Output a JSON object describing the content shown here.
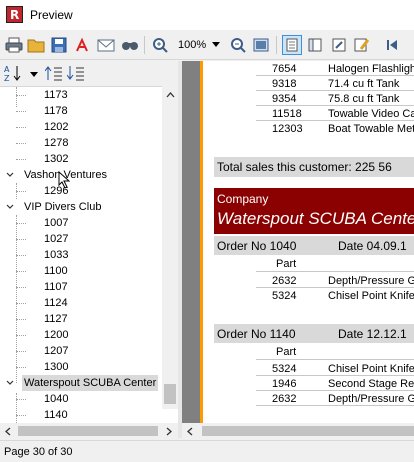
{
  "window": {
    "title": "Preview"
  },
  "toolbar": {
    "zoom": "100%"
  },
  "tree": {
    "items_top": [
      "1173",
      "1178",
      "1202",
      "1278",
      "1302"
    ],
    "vashon": {
      "label": "Vashon Ventures",
      "children": [
        "1296"
      ]
    },
    "vip": {
      "label": "VIP Divers Club",
      "children": [
        "1007",
        "1027",
        "1033",
        "1100",
        "1107",
        "1124",
        "1127",
        "1200",
        "1207",
        "1300"
      ]
    },
    "waterspout": {
      "label": "Waterspout SCUBA Center",
      "children": [
        "1040",
        "1140"
      ]
    }
  },
  "report": {
    "top_rows": [
      {
        "part": "7654",
        "desc": "Halogen Flashligh"
      },
      {
        "part": "9318",
        "desc": "71.4 cu ft Tank"
      },
      {
        "part": "9354",
        "desc": "75.8 cu ft Tank"
      },
      {
        "part": "11518",
        "desc": "Towable Video Ca"
      },
      {
        "part": "12303",
        "desc": "Boat Towable Met"
      }
    ],
    "total": "Total sales this customer: 225 56",
    "company_label": "Company",
    "company_name": "Waterspout SCUBA Cente",
    "order1": {
      "no": "Order No 1040",
      "date": "Date 04.09.1",
      "part_header": "Part",
      "rows": [
        {
          "part": "2632",
          "desc": "Depth/Pressure G"
        },
        {
          "part": "5324",
          "desc": "Chisel Point Knife"
        }
      ]
    },
    "order2": {
      "no": "Order No 1140",
      "date": "Date 12.12.1",
      "part_header": "Part",
      "rows": [
        {
          "part": "5324",
          "desc": "Chisel Point Knife"
        },
        {
          "part": "1946",
          "desc": "Second Stage Reg"
        },
        {
          "part": "2632",
          "desc": "Depth/Pressure G"
        }
      ]
    }
  },
  "status": {
    "page": "Page 30 of 30"
  },
  "colors": {
    "company_bg": "#8b0000",
    "accent": "#ff9900"
  }
}
